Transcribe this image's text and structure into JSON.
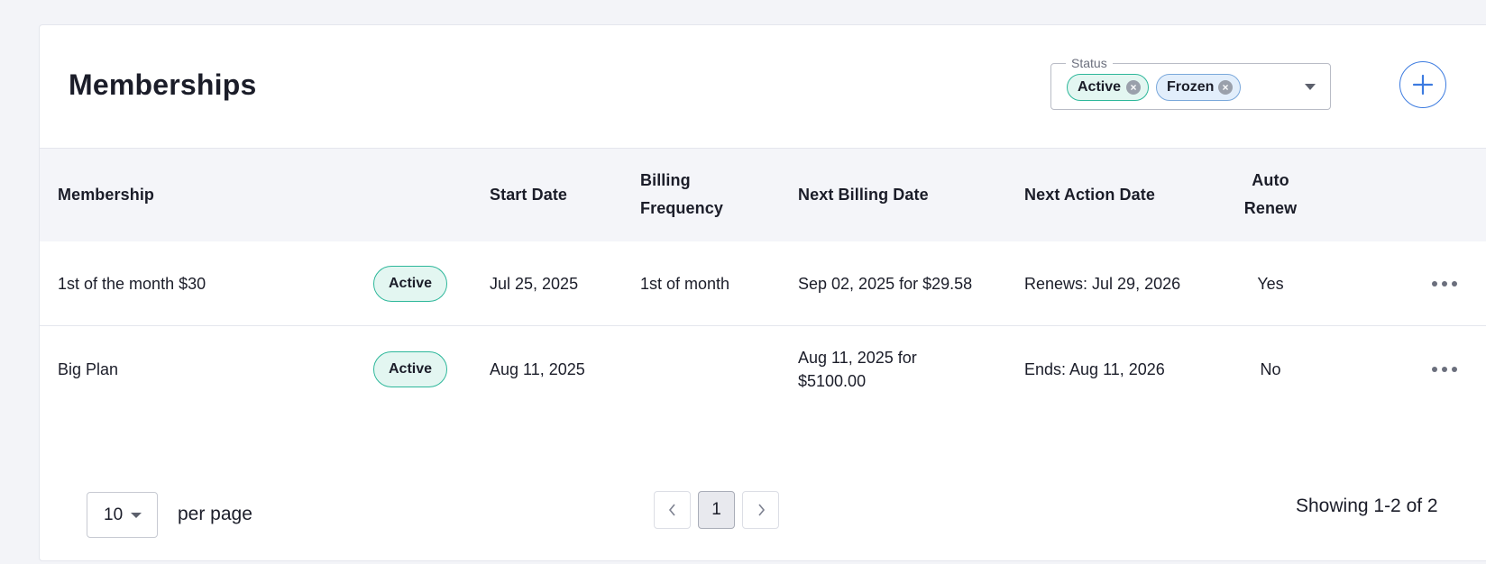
{
  "header": {
    "title": "Memberships",
    "status_filter": {
      "label": "Status",
      "chips": [
        {
          "label": "Active",
          "remove_icon": "close-circle-icon"
        },
        {
          "label": "Frozen",
          "remove_icon": "close-circle-icon"
        }
      ],
      "dropdown_icon": "caret-down-icon"
    },
    "add_icon": "plus-icon"
  },
  "table": {
    "columns": {
      "membership": "Membership",
      "start_date": "Start Date",
      "billing_frequency_line1": "Billing",
      "billing_frequency_line2": "Frequency",
      "next_billing_date": "Next Billing Date",
      "next_action_date": "Next Action Date",
      "auto_renew_line1": "Auto",
      "auto_renew_line2": "Renew"
    },
    "rows": [
      {
        "membership": "1st of the month $30",
        "status": "Active",
        "start_date": "Jul 25, 2025",
        "billing_frequency": "1st of month",
        "next_billing_line1": "Sep 02, 2025 for $29.58",
        "next_billing_line2": "",
        "next_action": "Renews: Jul 29, 2026",
        "auto_renew": "Yes",
        "menu_icon": "more-horizontal-icon"
      },
      {
        "membership": "Big Plan",
        "status": "Active",
        "start_date": "Aug 11, 2025",
        "billing_frequency": "",
        "next_billing_line1": "Aug 11, 2025 for",
        "next_billing_line2": "$5100.00",
        "next_action": "Ends: Aug 11, 2026",
        "auto_renew": "No",
        "menu_icon": "more-horizontal-icon"
      }
    ]
  },
  "footer": {
    "per_page_value": "10",
    "per_page_label": "per page",
    "current_page": "1",
    "prev_icon": "chevron-left-icon",
    "next_icon": "chevron-right-icon",
    "showing": "Showing 1-2 of 2"
  },
  "colors": {
    "accent": "#3c7be0",
    "active_green": "#2db79a",
    "active_bg": "#e3f6f1",
    "frozen_blue": "#7aa8db",
    "frozen_bg": "#e2eefb"
  }
}
